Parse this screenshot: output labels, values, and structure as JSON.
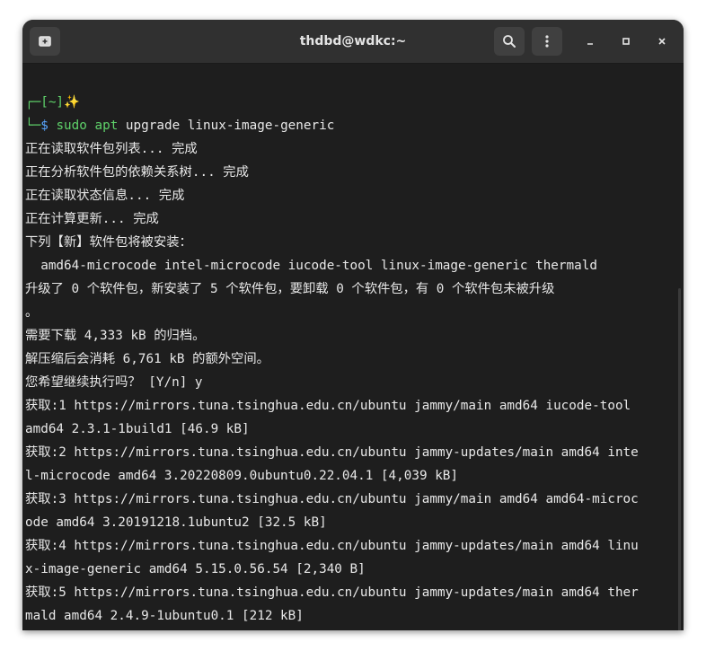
{
  "window": {
    "title": "thdbd@wdkc:~"
  },
  "icons": {
    "new_tab": "new-tab-icon",
    "search": "search-icon",
    "menu": "kebab-menu-icon",
    "minimize": "minimize-icon",
    "maximize": "maximize-icon",
    "close": "close-icon"
  },
  "colors": {
    "background": "#1e1e1e",
    "titlebar": "#303030",
    "prompt_green": "#5fd26a",
    "prompt_blue": "#59a7ff",
    "text": "#e8e8e8"
  },
  "prompt": {
    "corner_top": "┌─",
    "dir": "[~]",
    "sparkle": "✨",
    "corner_bottom": "└─",
    "symbol": "$",
    "sudo": "sudo",
    "apt": "apt",
    "args": "upgrade linux-image-generic"
  },
  "output": [
    "正在读取软件包列表... 完成",
    "正在分析软件包的依赖关系树... 完成",
    "正在读取状态信息... 完成",
    "正在计算更新... 完成",
    "下列【新】软件包将被安装：",
    "  amd64-microcode intel-microcode iucode-tool linux-image-generic thermald",
    "升级了 0 个软件包，新安装了 5 个软件包，要卸载 0 个软件包，有 0 个软件包未被升级",
    "。",
    "需要下载 4,333 kB 的归档。",
    "解压缩后会消耗 6,761 kB 的额外空间。",
    "您希望继续执行吗？ [Y/n] y",
    "获取:1 https://mirrors.tuna.tsinghua.edu.cn/ubuntu jammy/main amd64 iucode-tool",
    "amd64 2.3.1-1build1 [46.9 kB]",
    "获取:2 https://mirrors.tuna.tsinghua.edu.cn/ubuntu jammy-updates/main amd64 inte",
    "l-microcode amd64 3.20220809.0ubuntu0.22.04.1 [4,039 kB]",
    "获取:3 https://mirrors.tuna.tsinghua.edu.cn/ubuntu jammy/main amd64 amd64-microc",
    "ode amd64 3.20191218.1ubuntu2 [32.5 kB]",
    "获取:4 https://mirrors.tuna.tsinghua.edu.cn/ubuntu jammy-updates/main amd64 linu",
    "x-image-generic amd64 5.15.0.56.54 [2,340 B]",
    "获取:5 https://mirrors.tuna.tsinghua.edu.cn/ubuntu jammy-updates/main amd64 ther",
    "mald amd64 2.4.9-1ubuntu0.1 [212 kB]"
  ]
}
